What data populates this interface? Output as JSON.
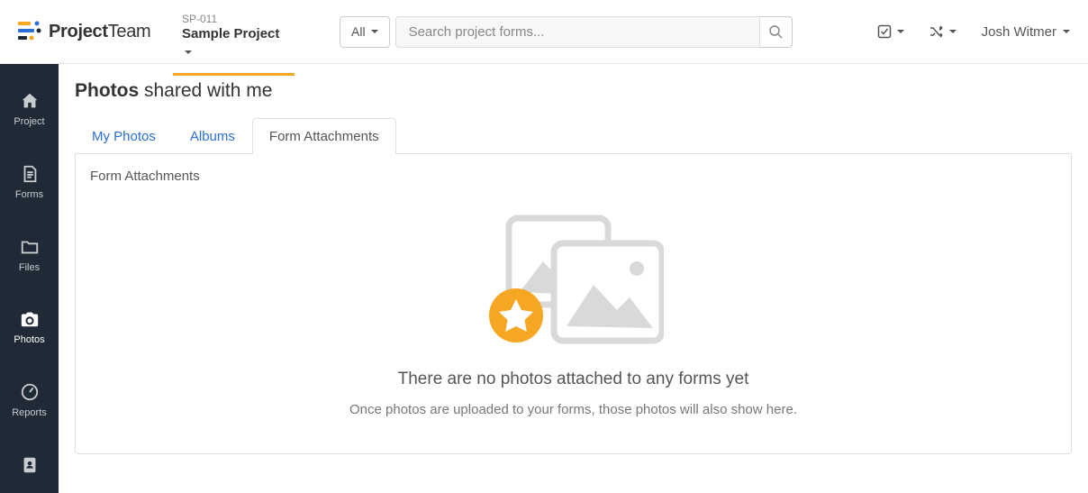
{
  "brand": {
    "text1": "Project",
    "text2": "Team"
  },
  "project": {
    "code": "SP-011",
    "name": "Sample Project"
  },
  "search": {
    "scope": "All",
    "placeholder": "Search project forms..."
  },
  "user": {
    "name": "Josh Witmer"
  },
  "sidebar": {
    "items": [
      {
        "label": "Project"
      },
      {
        "label": "Forms"
      },
      {
        "label": "Files"
      },
      {
        "label": "Photos"
      },
      {
        "label": "Reports"
      },
      {
        "label": ""
      }
    ]
  },
  "page": {
    "title_bold": "Photos",
    "title_rest": " shared with me"
  },
  "tabs": {
    "items": [
      {
        "label": "My Photos"
      },
      {
        "label": "Albums"
      },
      {
        "label": "Form Attachments"
      }
    ]
  },
  "panel": {
    "heading": "Form Attachments"
  },
  "empty": {
    "title": "There are no photos attached to any forms yet",
    "sub": "Once photos are uploaded to your forms, those photos will also show here."
  }
}
